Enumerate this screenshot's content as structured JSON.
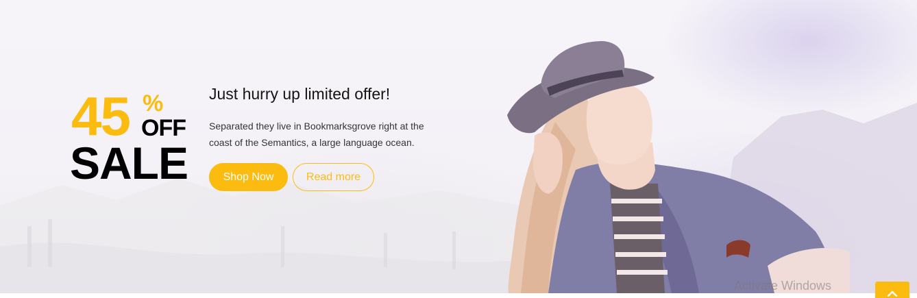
{
  "promo": {
    "discount_value": "45",
    "discount_unit": "%",
    "discount_off": "OFF",
    "sale_label": "SALE"
  },
  "offer": {
    "title": "Just hurry up limited offer!",
    "description": "Separated they live in Bookmarksgrove right at the coast of the Semantics, a large language ocean."
  },
  "buttons": {
    "shop_now": "Shop Now",
    "read_more": "Read more"
  },
  "overlay": {
    "activation_text": "Activate Windows",
    "scroll_top_icon": "chevron-up-icon"
  },
  "colors": {
    "accent": "#fcbc0f",
    "heading": "#000000",
    "text": "#333333"
  }
}
